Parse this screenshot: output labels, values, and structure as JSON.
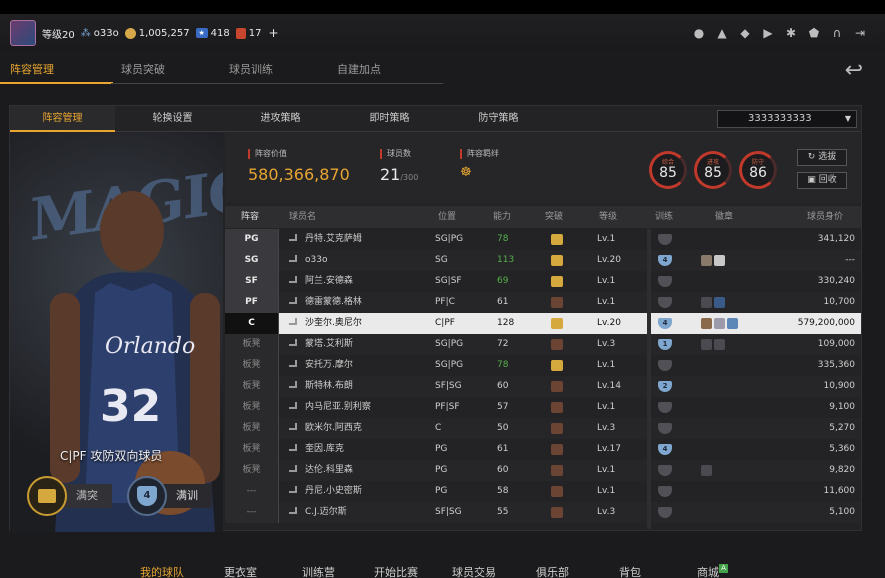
{
  "header": {
    "level": "等级20",
    "username": "o33o",
    "coins": "1,005,257",
    "tickets": "418",
    "ticket_badge": "★",
    "gems": "17",
    "plus": "+",
    "icons": [
      "user-icon",
      "bell-icon",
      "friends-icon",
      "video-icon",
      "gear-icon",
      "shield-icon",
      "headset-icon",
      "exit-icon"
    ]
  },
  "main_tabs": [
    "阵容管理",
    "球员突破",
    "球员训练",
    "自建加点"
  ],
  "sub_tabs": [
    "阵容管理",
    "轮换设置",
    "进攻策略",
    "即时策略",
    "防守策略"
  ],
  "lineup_select": "3333333333",
  "card": {
    "role": "C|PF 攻防双向球员",
    "logo": "MAGIC",
    "jersey_team": "Orlando",
    "jersey_number": "32",
    "breakthrough_label": "满突",
    "train_level": "4",
    "train_label": "满训"
  },
  "stats": {
    "value_label": "阵容价值",
    "value": "580,366,870",
    "count_label": "球员数",
    "count": "21",
    "count_max": "/300",
    "bond_label": "阵容羁绊",
    "rings": [
      {
        "label": "综合",
        "value": "85"
      },
      {
        "label": "进攻",
        "value": "85"
      },
      {
        "label": "防守",
        "value": "86"
      }
    ],
    "btn_select": "选拔",
    "btn_recycle": "回收"
  },
  "table": {
    "headers": [
      "阵容",
      "球员名",
      "位置",
      "能力",
      "突破",
      "等级",
      "训练",
      "徽章",
      "球员身价"
    ],
    "rows": [
      {
        "pos": "PG",
        "name": "丹特.艾克萨姆",
        "position": "SG|PG",
        "ability": "78",
        "green": true,
        "break": "gold",
        "level": "Lv.1",
        "train": "",
        "price": "341,120",
        "bench": false
      },
      {
        "pos": "SG",
        "name": "o33o",
        "position": "SG",
        "ability": "113",
        "green": true,
        "break": "gold",
        "level": "Lv.20",
        "train": "4",
        "price": "---",
        "bench": false
      },
      {
        "pos": "SF",
        "name": "阿兰.安德森",
        "position": "SG|SF",
        "ability": "69",
        "green": true,
        "break": "gold",
        "level": "Lv.1",
        "train": "",
        "price": "330,240",
        "bench": false
      },
      {
        "pos": "PF",
        "name": "德雷蒙德.格林",
        "position": "PF|C",
        "ability": "61",
        "green": false,
        "break": "brown",
        "level": "Lv.1",
        "train": "",
        "price": "10,700",
        "bench": false
      },
      {
        "pos": "C",
        "name": "沙奎尔.奥尼尔",
        "position": "C|PF",
        "ability": "128",
        "green": false,
        "break": "gold",
        "level": "Lv.20",
        "train": "4",
        "price": "579,200,000",
        "bench": false,
        "selected": true
      },
      {
        "pos": "板凳",
        "name": "蒙塔.艾利斯",
        "position": "SG|PG",
        "ability": "72",
        "green": false,
        "break": "brown",
        "level": "Lv.3",
        "train": "1",
        "price": "109,000",
        "bench": true
      },
      {
        "pos": "板凳",
        "name": "安托万.摩尔",
        "position": "SG|PG",
        "ability": "78",
        "green": true,
        "break": "gold",
        "level": "Lv.1",
        "train": "",
        "price": "335,360",
        "bench": true
      },
      {
        "pos": "板凳",
        "name": "斯特林.布朗",
        "position": "SF|SG",
        "ability": "60",
        "green": false,
        "break": "brown",
        "level": "Lv.14",
        "train": "2",
        "price": "10,900",
        "bench": true
      },
      {
        "pos": "板凳",
        "name": "内马尼亚.别利察",
        "position": "PF|SF",
        "ability": "57",
        "green": false,
        "break": "brown",
        "level": "Lv.1",
        "train": "",
        "price": "9,100",
        "bench": true
      },
      {
        "pos": "板凳",
        "name": "欧米尔.阿西克",
        "position": "C",
        "ability": "50",
        "green": false,
        "break": "brown",
        "level": "Lv.3",
        "train": "",
        "price": "5,270",
        "bench": true
      },
      {
        "pos": "板凳",
        "name": "奎因.库克",
        "position": "PG",
        "ability": "61",
        "green": false,
        "break": "brown",
        "level": "Lv.17",
        "train": "4",
        "price": "5,360",
        "bench": true
      },
      {
        "pos": "板凳",
        "name": "达伦.科里森",
        "position": "PG",
        "ability": "60",
        "green": false,
        "break": "brown",
        "level": "Lv.1",
        "train": "",
        "price": "9,820",
        "bench": true
      },
      {
        "pos": "---",
        "name": "丹尼.小史密斯",
        "position": "PG",
        "ability": "58",
        "green": false,
        "break": "brown",
        "level": "Lv.1",
        "train": "",
        "price": "11,600",
        "bench": true
      },
      {
        "pos": "---",
        "name": "C.J.迈尔斯",
        "position": "SF|SG",
        "ability": "55",
        "green": false,
        "break": "brown",
        "level": "Lv.3",
        "train": "",
        "price": "5,100",
        "bench": true
      }
    ]
  },
  "bottom_nav": [
    "我的球队",
    "更衣室",
    "训练营",
    "开始比赛",
    "球员交易",
    "俱乐部",
    "背包",
    "商城"
  ],
  "new_mark": "A",
  "colors": {
    "accent": "#e8a531",
    "red": "#c0392b",
    "green": "#55b04a"
  }
}
